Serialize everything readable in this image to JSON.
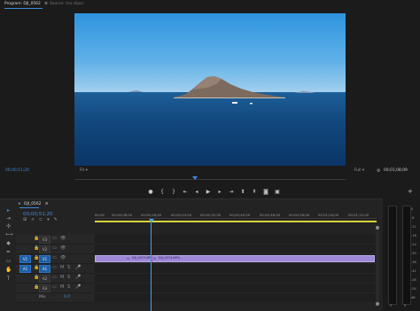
{
  "program_tab": "Program: DJI_0562",
  "program_menu_icon": "≡",
  "source_tab": "Source: (no clips)",
  "timecode_current": "00;00;51;20",
  "fit_label": "Fit",
  "quality_label": "Full",
  "timecode_duration": "00;01;08;09",
  "sequence_tab": "DJI_0562",
  "sequence_timecode": "00;00;51;20",
  "ruler_labels": [
    "00;00",
    "00;00;08;00",
    "00;00;16;00",
    "00;00;24;00",
    "00;00;32;00",
    "00;00;40;00",
    "00;00;48;00",
    "00;00;56;00",
    "00;01;04;00",
    "00;01;12;00"
  ],
  "video_tracks": [
    "V3",
    "V2",
    "V1"
  ],
  "audio_tracks": [
    "A1",
    "A2",
    "A3"
  ],
  "source_patch_video": "V1",
  "source_patch_audio": "A1",
  "mix_label": "Mix",
  "mix_value": "0.0",
  "clip1_label": "DJI_0373.MP",
  "clip2_label": "DJI_0374.MP4",
  "meter_ticks": [
    "0",
    "-6",
    "-12",
    "-18",
    "-24",
    "-30",
    "-36",
    "-42",
    "-48",
    "-54",
    "dB"
  ],
  "meter_solo": [
    "S",
    "S"
  ],
  "colors": {
    "accent": "#3d8bdb",
    "clip": "#9e88d8",
    "playhead": "#4d9ee8",
    "sequence_bar": "#d9d43a"
  },
  "icons": [
    "marker-icon",
    "in-point-icon",
    "out-point-icon",
    "go-to-in-icon",
    "step-back-icon",
    "play-icon",
    "step-forward-icon",
    "go-to-out-icon",
    "lift-icon",
    "extract-icon",
    "export-frame-icon",
    "button-editor-icon",
    "settings-icon",
    "wrench-icon"
  ]
}
